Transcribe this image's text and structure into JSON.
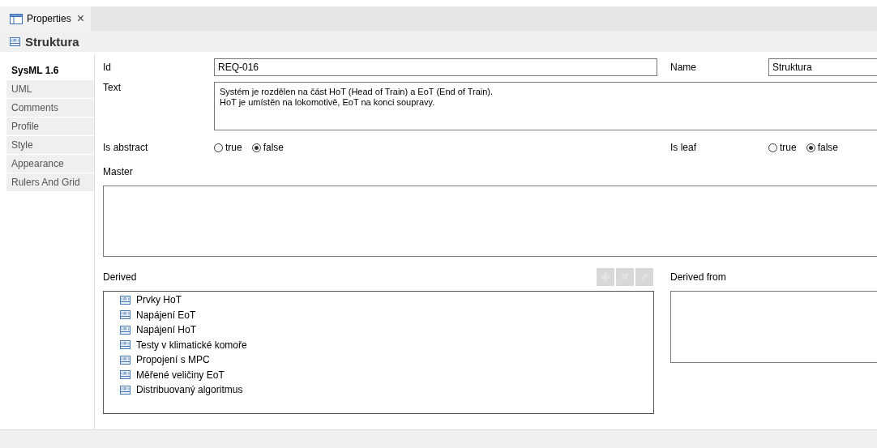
{
  "view_tab": {
    "label": "Properties",
    "close": "×"
  },
  "header": {
    "title": "Struktura"
  },
  "sidebar": {
    "items": [
      {
        "label": "SysML 1.6",
        "selected": true
      },
      {
        "label": "UML",
        "selected": false
      },
      {
        "label": "Comments",
        "selected": false
      },
      {
        "label": "Profile",
        "selected": false
      },
      {
        "label": "Style",
        "selected": false
      },
      {
        "label": "Appearance",
        "selected": false
      },
      {
        "label": "Rulers And Grid",
        "selected": false
      }
    ]
  },
  "form": {
    "id": {
      "label": "Id",
      "value": "REQ-016"
    },
    "name": {
      "label": "Name",
      "value": "Struktura"
    },
    "text": {
      "label": "Text",
      "lines": [
        "Systém je rozdělen na část HoT (Head of Train) a EoT (End of Train).",
        "HoT je umístěn na lokomotivě, EoT na konci soupravy."
      ]
    },
    "is_abstract": {
      "label": "Is abstract",
      "options": [
        {
          "label": "true",
          "selected": false
        },
        {
          "label": "false",
          "selected": true
        }
      ]
    },
    "is_leaf": {
      "label": "Is leaf",
      "options": [
        {
          "label": "true",
          "selected": false
        },
        {
          "label": "false",
          "selected": true
        }
      ]
    },
    "master": {
      "label": "Master"
    },
    "derived": {
      "label": "Derived",
      "buttons": [
        {
          "kind": "add",
          "disabled": true
        },
        {
          "kind": "delete",
          "disabled": true
        },
        {
          "kind": "edit",
          "disabled": true
        }
      ],
      "items": [
        "Prvky HoT",
        "Napájení EoT",
        "Napájení HoT",
        "Testy v klimatické komoře",
        "Propojení s MPC",
        "Měřené veličiny EoT",
        "Distribuovaný algoritmus"
      ]
    },
    "derived_from": {
      "label": "Derived from"
    }
  }
}
